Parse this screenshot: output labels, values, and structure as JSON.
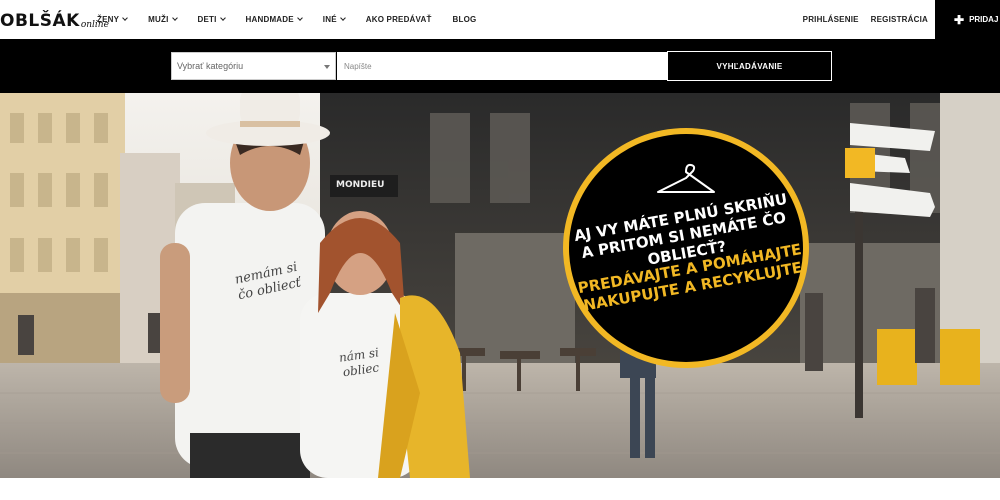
{
  "logo": {
    "main": "OBLŠÁK",
    "sub": "online"
  },
  "nav": {
    "items": [
      {
        "label": "ŽENY",
        "dropdown": true
      },
      {
        "label": "MUŽI",
        "dropdown": true
      },
      {
        "label": "DETI",
        "dropdown": true
      },
      {
        "label": "HANDMADE",
        "dropdown": true
      },
      {
        "label": "INÉ",
        "dropdown": true
      },
      {
        "label": "AKO PREDÁVAŤ",
        "dropdown": false
      },
      {
        "label": "BLOG",
        "dropdown": false
      }
    ],
    "login": "PRIHLÁSENIE",
    "register": "REGISTRÁCIA",
    "add_button": "PRIDAJ I"
  },
  "search": {
    "category_value": "Vybrať kategóriu",
    "input_placeholder": "Napíšte",
    "button_label": "VYHĽADÁVANIE"
  },
  "hero": {
    "badge_line1": "AJ VY MÁTE PLNÚ SKRIŇU",
    "badge_line2": "A PRITOM SI NEMÁTE ČO OBLIECŤ?",
    "badge_line3": "PREDÁVAJTE A POMÁHAJTE",
    "badge_line4": "NAKUPUJTE A RECYKLUJTE",
    "shirt_text_1a": "nemám si",
    "shirt_text_1b": "čo obliecť",
    "shirt_text_2a": "nám si",
    "shirt_text_2b": "obliec",
    "shop_sign": "MONDIEU"
  },
  "colors": {
    "accent_yellow": "#f2b824",
    "nav_black": "#000000"
  }
}
